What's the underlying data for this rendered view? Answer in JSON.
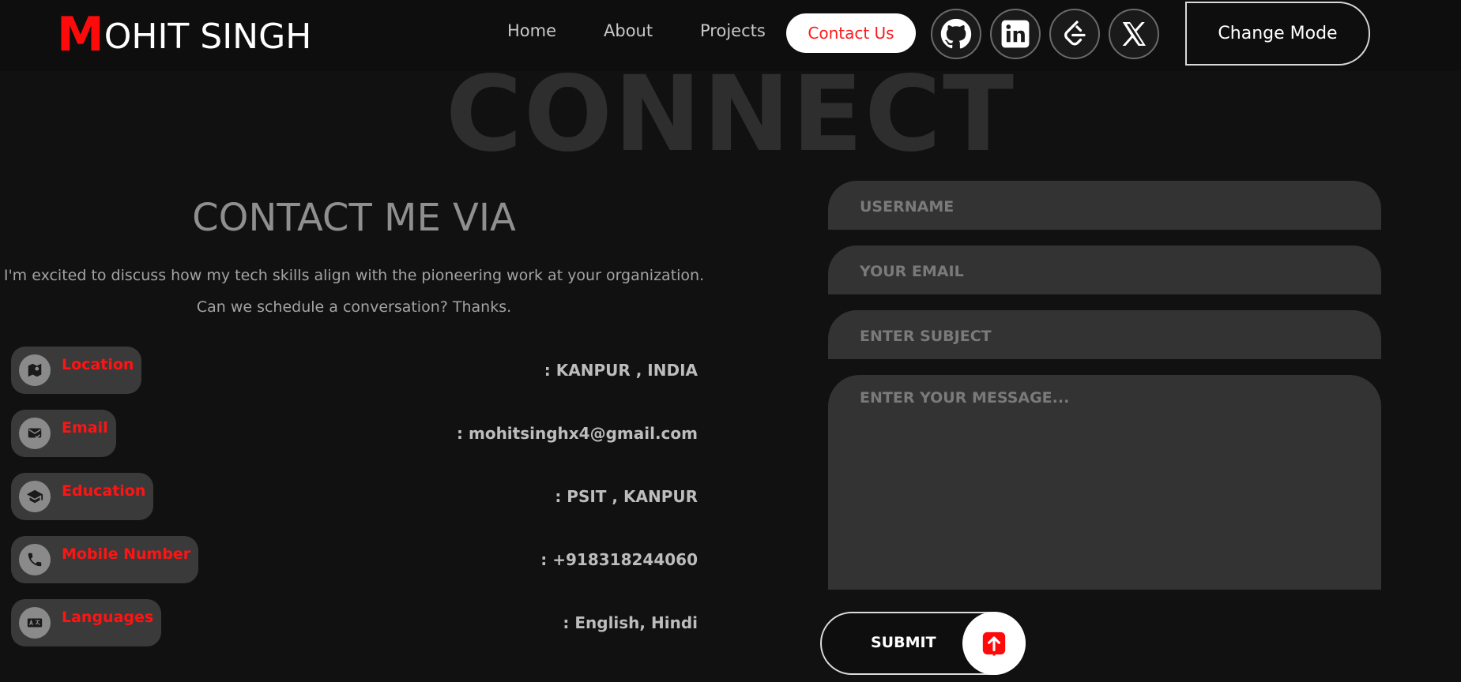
{
  "brand": {
    "initial": "M",
    "rest": "OHIT SINGH"
  },
  "nav": {
    "home": "Home",
    "about": "About",
    "projects": "Projects",
    "contact": "Contact Us",
    "change_mode": "Change Mode"
  },
  "social_icons": [
    "github-icon",
    "linkedin-icon",
    "leetcode-icon",
    "x-icon"
  ],
  "hero_word": "CONNECT",
  "contact": {
    "title": "CONTACT ME VIA",
    "intro_line1": "I'm excited to discuss how my tech skills align with the pioneering work at your organization.",
    "intro_line2": "Can we schedule a conversation? Thanks.",
    "items": [
      {
        "label": "Location",
        "value": ": KANPUR , INDIA",
        "icon": "map-icon"
      },
      {
        "label": "Email",
        "value": ": mohitsinghx4@gmail.com",
        "icon": "mail-check-icon"
      },
      {
        "label": "Education",
        "value": ": PSIT , KANPUR",
        "icon": "graduation-cap-icon"
      },
      {
        "label": "Mobile Number",
        "value": ": +918318244060",
        "icon": "phone-icon"
      },
      {
        "label": "Languages",
        "value": ": English, Hindi",
        "icon": "translate-icon"
      }
    ]
  },
  "form": {
    "username_placeholder": "USERNAME",
    "email_placeholder": "YOUR EMAIL",
    "subject_placeholder": "ENTER SUBJECT",
    "message_placeholder": "ENTER YOUR MESSAGE...",
    "submit_label": "SUBMIT"
  },
  "colors": {
    "accent": "#ff0a0a",
    "background": "#111111",
    "field": "#333333",
    "pill": "#3a3a3a"
  }
}
